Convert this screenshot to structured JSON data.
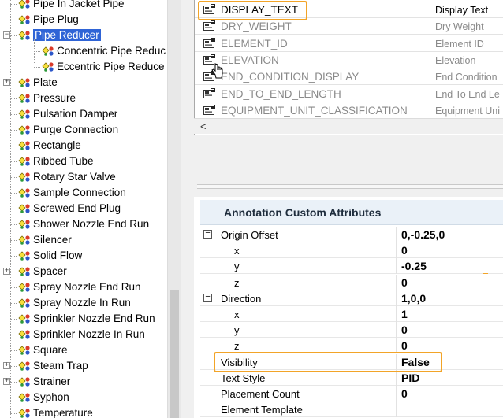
{
  "tree": {
    "items": [
      {
        "label": "Pipe In Jacket Pipe"
      },
      {
        "label": "Pipe Plug"
      },
      {
        "label": "Pipe Reducer",
        "expander": "−",
        "selected": true
      },
      {
        "label": "Concentric Pipe Reduc",
        "child": true
      },
      {
        "label": "Eccentric Pipe Reduce",
        "child": true
      },
      {
        "label": "Plate",
        "expander": "+"
      },
      {
        "label": "Pressure"
      },
      {
        "label": "Pulsation Damper"
      },
      {
        "label": "Purge Connection"
      },
      {
        "label": "Rectangle"
      },
      {
        "label": "Ribbed Tube"
      },
      {
        "label": "Rotary Star Valve"
      },
      {
        "label": "Sample Connection"
      },
      {
        "label": "Screwed End Plug"
      },
      {
        "label": "Shower Nozzle End Run"
      },
      {
        "label": "Silencer"
      },
      {
        "label": "Solid Flow"
      },
      {
        "label": "Spacer",
        "expander": "+"
      },
      {
        "label": "Spray Nozzle End Run"
      },
      {
        "label": "Spray Nozzle In Run"
      },
      {
        "label": "Sprinkler Nozzle End Run"
      },
      {
        "label": "Sprinkler Nozzle In Run"
      },
      {
        "label": "Square"
      },
      {
        "label": "Steam Trap",
        "expander": "+"
      },
      {
        "label": "Strainer",
        "expander": "+"
      },
      {
        "label": "Syphon"
      },
      {
        "label": "Temperature"
      }
    ]
  },
  "grid": {
    "rows": [
      {
        "name": "DISPLAY_TEXT",
        "value": "Display Text",
        "active": true
      },
      {
        "name": "DRY_WEIGHT",
        "value": "Dry Weight"
      },
      {
        "name": "ELEMENT_ID",
        "value": "Element ID"
      },
      {
        "name": "ELEVATION",
        "value": "Elevation"
      },
      {
        "name": "END_CONDITION_DISPLAY",
        "value": "End Condition"
      },
      {
        "name": "END_TO_END_LENGTH",
        "value": "End To End Le"
      },
      {
        "name": "EQUIPMENT_UNIT_CLASSIFICATION",
        "value": "Equipment Uni"
      }
    ],
    "scroll_left_arrow": "<"
  },
  "attributes": {
    "title": "Annotation Custom Attributes",
    "rows": [
      {
        "name": "Origin Offset",
        "value": "0,-0.25,0",
        "group": true,
        "toggle": "−"
      },
      {
        "name": "x",
        "value": "0",
        "indent": true
      },
      {
        "name": "y",
        "value": "-0.25",
        "indent": true
      },
      {
        "name": "z",
        "value": "0",
        "indent": true
      },
      {
        "name": "Direction",
        "value": "1,0,0",
        "group": true,
        "toggle": "−"
      },
      {
        "name": "x",
        "value": "1",
        "indent": true
      },
      {
        "name": "y",
        "value": "0",
        "indent": true
      },
      {
        "name": "z",
        "value": "0",
        "indent": true
      },
      {
        "name": "Visibility",
        "value": "False"
      },
      {
        "name": "Text Style",
        "value": "PID"
      },
      {
        "name": "Placement Count",
        "value": "0"
      },
      {
        "name": "Element Template",
        "value": ""
      }
    ]
  },
  "colors": {
    "highlight": "#f2a428",
    "selection": "#2f64d6",
    "header_bg": "#eaf1f8"
  }
}
